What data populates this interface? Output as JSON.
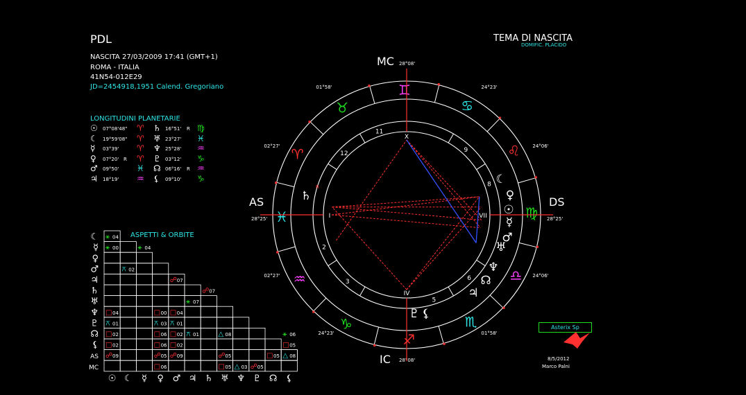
{
  "header": {
    "name": "PDL",
    "birth_line": "NASCITA 27/03/2009 17:41 (GMT+1)",
    "place": "ROMA - ITALIA",
    "coords": "41N54-012E29",
    "jd_line": "JD=2454918,1951  Calend. Gregoriano"
  },
  "chart_title": "TEMA DI NASCITA",
  "house_system": "DOMIFIC. PLACIDO",
  "longitudes": {
    "title": "LONGITUDINI PLANETARIE",
    "rows": [
      {
        "p1": "sun",
        "v1": "07°08'48\"",
        "r1": "",
        "s1": "aries",
        "p2": "saturn",
        "v2": "16°51'",
        "r2": "R",
        "s2": "virgo"
      },
      {
        "p1": "moon",
        "v1": "19°59'08\"",
        "r1": "",
        "s1": "aries",
        "p2": "uranus",
        "v2": "23°27'",
        "r2": "",
        "s2": "pisces"
      },
      {
        "p1": "mercury",
        "v1": "03°39'",
        "r1": "",
        "s1": "aries",
        "p2": "neptune",
        "v2": "25°28'",
        "r2": "",
        "s2": "aquarius"
      },
      {
        "p1": "venus",
        "v1": "07°20'",
        "r1": "R",
        "s1": "aries",
        "p2": "pluto",
        "v2": "03°12'",
        "r2": "",
        "s2": "capricorn"
      },
      {
        "p1": "mars",
        "v1": "09°50'",
        "r1": "",
        "s1": "pisces",
        "p2": "node",
        "v2": "06°16'",
        "r2": "R",
        "s2": "aquarius"
      },
      {
        "p1": "jupiter",
        "v1": "18°19'",
        "r1": "",
        "s1": "aquarius",
        "p2": "lilith",
        "v2": "09°10'",
        "r2": "",
        "s2": "capricorn"
      }
    ]
  },
  "aspects": {
    "title": "ASPETTI  &  ORBITE",
    "row_labels": [
      "moon",
      "mercury",
      "venus",
      "mars",
      "jupiter",
      "saturn",
      "uranus",
      "neptune",
      "pluto",
      "node",
      "lilith",
      "AS",
      "MC"
    ],
    "col_labels": [
      "sun",
      "moon",
      "mercury",
      "venus",
      "mars",
      "jupiter",
      "saturn",
      "uranus",
      "neptune",
      "pluto",
      "node",
      "lilith"
    ],
    "cells": [
      {
        "r": 0,
        "c": 0,
        "sym": "sextile",
        "orb": "04",
        "color": "#1fdc1f"
      },
      {
        "r": 1,
        "c": 0,
        "sym": "sextile",
        "orb": "00",
        "color": "#1fdc1f"
      },
      {
        "r": 1,
        "c": 2,
        "sym": "sextile",
        "orb": "04",
        "color": "#1fdc1f"
      },
      {
        "r": 3,
        "c": 1,
        "sym": "quincunx",
        "orb": "02",
        "color": "#2ee6e6"
      },
      {
        "r": 4,
        "c": 4,
        "sym": "opposition",
        "orb": "07",
        "color": "#ff3030"
      },
      {
        "r": 5,
        "c": 6,
        "sym": "opposition",
        "orb": "07",
        "color": "#ff3030"
      },
      {
        "r": 6,
        "c": 5,
        "sym": "sextile",
        "orb": "07",
        "color": "#1fdc1f"
      },
      {
        "r": 7,
        "c": 0,
        "sym": "square",
        "orb": "04",
        "color": "#ff3030"
      },
      {
        "r": 7,
        "c": 3,
        "sym": "square",
        "orb": "00",
        "color": "#ff3030"
      },
      {
        "r": 7,
        "c": 4,
        "sym": "square",
        "orb": "04",
        "color": "#ff3030"
      },
      {
        "r": 8,
        "c": 0,
        "sym": "quincunx",
        "orb": "01",
        "color": "#2ee6e6"
      },
      {
        "r": 8,
        "c": 3,
        "sym": "quincunx",
        "orb": "03",
        "color": "#2ee6e6"
      },
      {
        "r": 8,
        "c": 4,
        "sym": "quincunx",
        "orb": "01",
        "color": "#2ee6e6"
      },
      {
        "r": 9,
        "c": 0,
        "sym": "square",
        "orb": "02",
        "color": "#ff3030"
      },
      {
        "r": 9,
        "c": 3,
        "sym": "square",
        "orb": "06",
        "color": "#ff3030"
      },
      {
        "r": 9,
        "c": 4,
        "sym": "square",
        "orb": "02",
        "color": "#ff3030"
      },
      {
        "r": 9,
        "c": 5,
        "sym": "quincunx",
        "orb": "01",
        "color": "#2ee6e6"
      },
      {
        "r": 9,
        "c": 7,
        "sym": "trine",
        "orb": "08",
        "color": "#2ee6e6"
      },
      {
        "r": 9,
        "c": 11,
        "sym": "sextile",
        "orb": "06",
        "color": "#1fdc1f"
      },
      {
        "r": 10,
        "c": 0,
        "sym": "square",
        "orb": "02",
        "color": "#ff3030"
      },
      {
        "r": 10,
        "c": 3,
        "sym": "square",
        "orb": "06",
        "color": "#ff3030"
      },
      {
        "r": 10,
        "c": 4,
        "sym": "square",
        "orb": "02",
        "color": "#ff3030"
      },
      {
        "r": 10,
        "c": 11,
        "sym": "square",
        "orb": "05",
        "color": "#ff3030"
      },
      {
        "r": 11,
        "c": 0,
        "sym": "opposition",
        "orb": "09",
        "color": "#ff3030"
      },
      {
        "r": 11,
        "c": 3,
        "sym": "opposition",
        "orb": "05",
        "color": "#ff3030"
      },
      {
        "r": 11,
        "c": 4,
        "sym": "opposition",
        "orb": "09",
        "color": "#ff3030"
      },
      {
        "r": 11,
        "c": 7,
        "sym": "opposition",
        "orb": "05",
        "color": "#ff3030"
      },
      {
        "r": 11,
        "c": 10,
        "sym": "square",
        "orb": "05",
        "color": "#ff3030"
      },
      {
        "r": 11,
        "c": 11,
        "sym": "trine",
        "orb": "08",
        "color": "#2ee6e6"
      },
      {
        "r": 12,
        "c": 3,
        "sym": "square",
        "orb": "06",
        "color": "#ff3030"
      },
      {
        "r": 12,
        "c": 7,
        "sym": "square",
        "orb": "05",
        "color": "#ff3030"
      },
      {
        "r": 12,
        "c": 8,
        "sym": "trine",
        "orb": "03",
        "color": "#2ee6e6"
      },
      {
        "r": 12,
        "c": 9,
        "sym": "opposition",
        "orb": "05",
        "color": "#ff3030"
      }
    ]
  },
  "angles": {
    "mc": "MC",
    "mc_deg": "28°08'",
    "ic": "IC",
    "ic_deg": "28°08'",
    "as": "AS",
    "as_deg": "28°25'",
    "ds": "DS",
    "ds_deg": "28°25'"
  },
  "cusp_degrees": [
    "01°58'",
    "24°23'",
    "24°06'",
    "02°27'",
    "01°58'",
    "24°23'",
    "24°06'",
    "02°27'"
  ],
  "house_numbers": [
    "X",
    "9",
    "8",
    "VII",
    "6",
    "5",
    "IV",
    "3",
    "2",
    "I",
    "12",
    "11"
  ],
  "sign_glyphs": [
    "gemini",
    "taurus",
    "aries",
    "pisces",
    "aquarius",
    "capricorn",
    "sagittarius",
    "scorpio",
    "libra",
    "virgo",
    "leo",
    "cancer"
  ],
  "wheel_planets": [
    "moon",
    "venus",
    "sun",
    "mercury",
    "mars",
    "uranus",
    "neptune",
    "node",
    "pluto",
    "lilith",
    "saturn",
    "jupiter"
  ],
  "retro_mark": "R",
  "asterix_label": "Asterix Sp",
  "date_stamp": "8/5/2012",
  "author": "Marco Palni",
  "colors": {
    "red": "#ff3030",
    "cyan": "#2ee6e6",
    "green": "#1fdc1f",
    "magenta": "#ff40ff",
    "blue": "#3050ff",
    "white": "#ffffff"
  }
}
